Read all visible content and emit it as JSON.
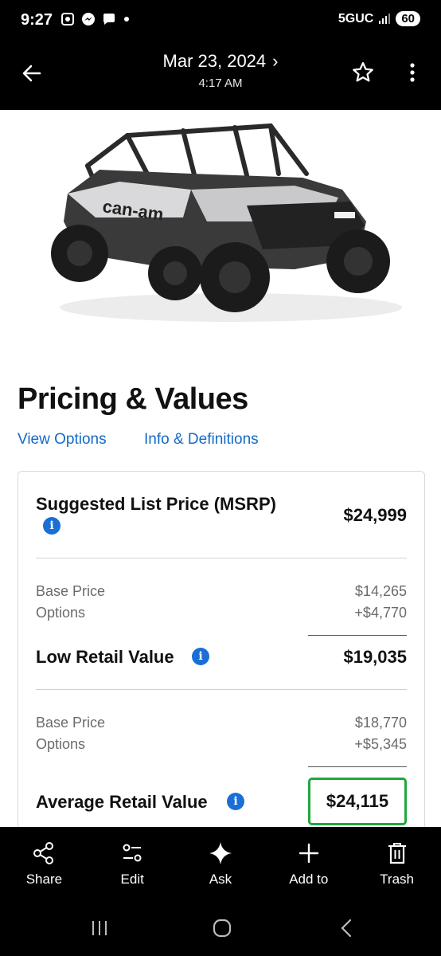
{
  "status": {
    "time": "9:27",
    "network": "5GUC",
    "battery": "60",
    "left_icons": [
      "screenshot-icon",
      "messenger-icon",
      "chat-icon",
      "dot-icon"
    ]
  },
  "header": {
    "date": "Mar 23, 2024",
    "time": "4:17 AM",
    "chevron": "›"
  },
  "page": {
    "title": "Pricing & Values",
    "links": {
      "options": "View Options",
      "info": "Info & Definitions"
    }
  },
  "pricing": {
    "msrp": {
      "label": "Suggested List Price (MSRP)",
      "value": "$24,999"
    },
    "low": {
      "base_label": "Base Price",
      "base_value": "$14,265",
      "options_label": "Options",
      "options_value": "+$4,770",
      "label": "Low Retail Value",
      "value": "$19,035"
    },
    "average": {
      "base_label": "Base Price",
      "base_value": "$18,770",
      "options_label": "Options",
      "options_value": "+$5,345",
      "label": "Average Retail Value",
      "value": "$24,115"
    },
    "info_glyph": "i"
  },
  "actions": [
    {
      "label": "Share",
      "icon": "share-icon"
    },
    {
      "label": "Edit",
      "icon": "edit-icon"
    },
    {
      "label": "Ask",
      "icon": "sparkle-icon"
    },
    {
      "label": "Add to",
      "icon": "plus-icon"
    },
    {
      "label": "Trash",
      "icon": "trash-icon"
    }
  ],
  "colors": {
    "link": "#1469c7",
    "info": "#1a6fd6",
    "highlight": "#1fa83b"
  }
}
